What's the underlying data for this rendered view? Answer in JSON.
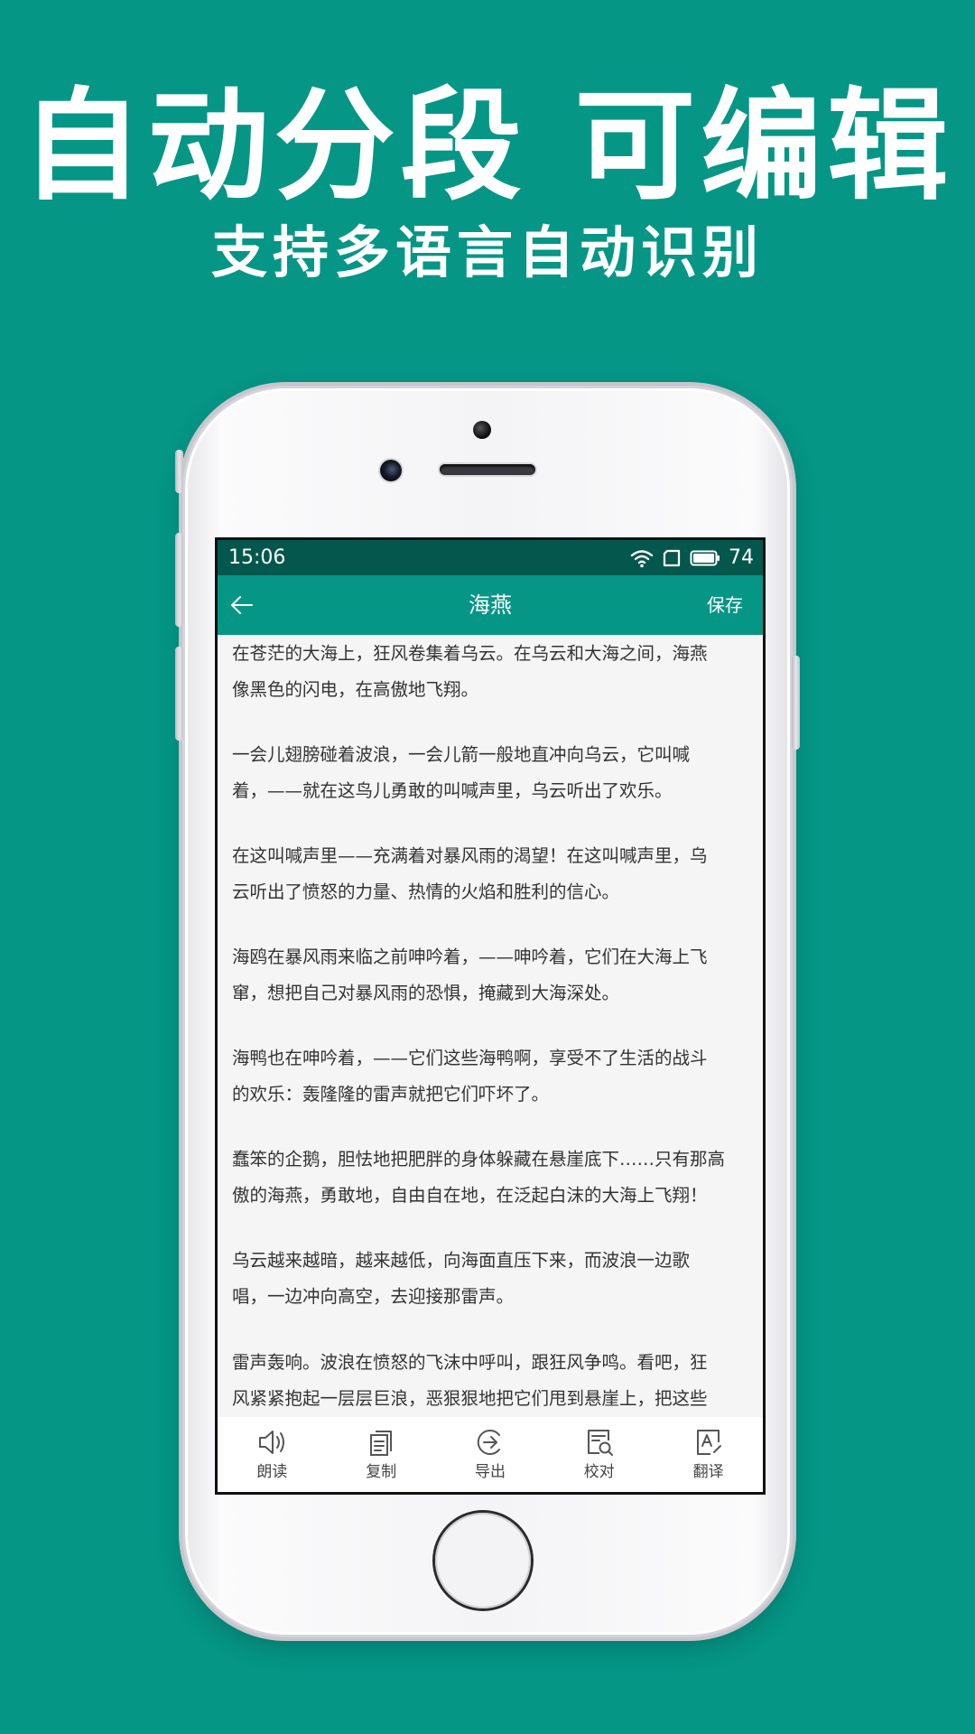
{
  "promo": {
    "headline": "自动分段 可编辑",
    "subline": "支持多语言自动识别"
  },
  "status_bar": {
    "time": "15:06",
    "battery": "74",
    "icons": [
      "wifi-icon",
      "sim-icon",
      "battery-icon"
    ]
  },
  "app_bar": {
    "back_icon": "back-arrow-icon",
    "title": "海燕",
    "save_label": "保存"
  },
  "content": {
    "paragraphs": [
      "在苍茫的大海上，狂风卷集着乌云。在乌云和大海之间，海燕\n像黑色的闪电，在高傲地飞翔。",
      "一会儿翅膀碰着波浪，一会儿箭一般地直冲向乌云，它叫喊\n着，——就在这鸟儿勇敢的叫喊声里，乌云听出了欢乐。",
      "在这叫喊声里——充满着对暴风雨的渴望！在这叫喊声里，乌\n云听出了愤怒的力量、热情的火焰和胜利的信心。",
      "海鸥在暴风雨来临之前呻吟着，——呻吟着，它们在大海上飞\n窜，想把自己对暴风雨的恐惧，掩藏到大海深处。",
      "海鸭也在呻吟着，——它们这些海鸭啊，享受不了生活的战斗\n的欢乐：轰隆隆的雷声就把它们吓坏了。",
      "蠢笨的企鹅，胆怯地把肥胖的身体躲藏在悬崖底下……只有那高\n傲的海燕，勇敢地，自由自在地，在泛起白沫的大海上飞翔！",
      "乌云越来越暗，越来越低，向海面直压下来，而波浪一边歌\n唱，一边冲向高空，去迎接那雷声。",
      "雷声轰响。波浪在愤怒的飞沫中呼叫，跟狂风争鸣。看吧，狂\n风紧紧抱起一层层巨浪，恶狠狠地把它们甩到悬崖上，把这些"
    ]
  },
  "toolbar": {
    "items": [
      {
        "label": "朗读",
        "icon": "speaker-icon"
      },
      {
        "label": "复制",
        "icon": "copy-icon"
      },
      {
        "label": "导出",
        "icon": "export-icon"
      },
      {
        "label": "校对",
        "icon": "proofread-icon"
      },
      {
        "label": "翻译",
        "icon": "translate-icon"
      }
    ]
  },
  "colors": {
    "brand_green": "#059686",
    "status_bar_dark_green": "#04574d",
    "content_background": "#f5f5f5",
    "text": "#333333"
  }
}
